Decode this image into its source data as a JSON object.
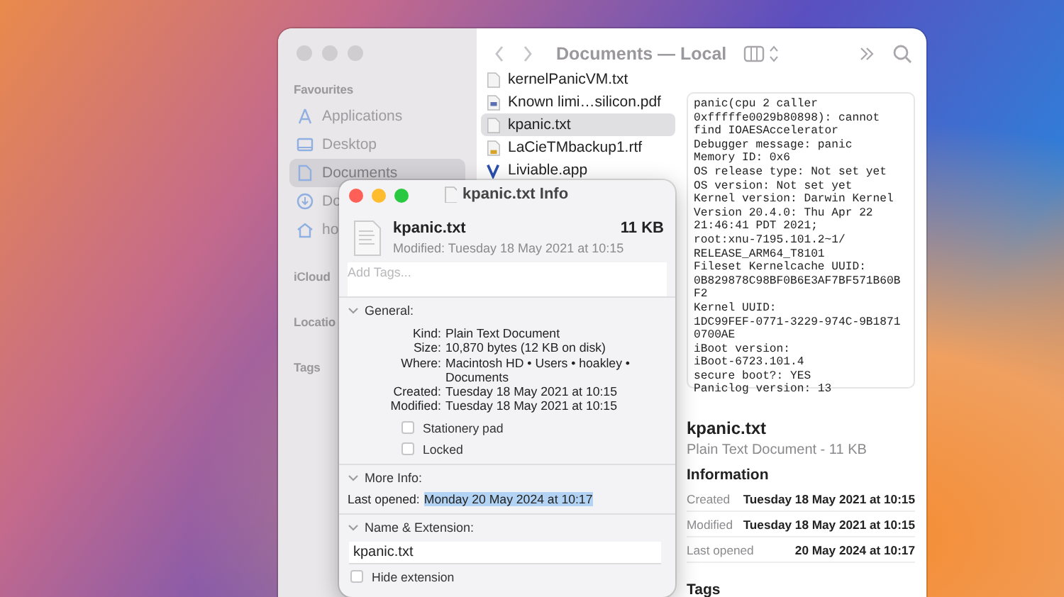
{
  "finder": {
    "title": "Documents — Local",
    "sidebar": {
      "sections": [
        {
          "label": "Favourites",
          "items": [
            {
              "label": "Applications",
              "selected": false
            },
            {
              "label": "Desktop",
              "selected": false
            },
            {
              "label": "Documents",
              "selected": true
            },
            {
              "label": "Do",
              "selected": false
            },
            {
              "label": "ho",
              "selected": false
            }
          ]
        },
        {
          "label": "iCloud"
        },
        {
          "label": "Locatio"
        },
        {
          "label": "Tags"
        }
      ]
    },
    "files": [
      {
        "name": "kernelPanicVM.txt",
        "kind": "text",
        "selected": false
      },
      {
        "name": "Known limi…silicon.pdf",
        "kind": "pdf",
        "selected": false
      },
      {
        "name": "kpanic.txt",
        "kind": "text",
        "selected": true
      },
      {
        "name": "LaCieTMbackup1.rtf",
        "kind": "rtf",
        "selected": false
      },
      {
        "name": "Liviable.app",
        "kind": "app",
        "selected": false
      }
    ],
    "preview": {
      "lines": [
        "panic(cpu 2 caller",
        "0xfffffe0029b80898): cannot",
        "find IOAESAccelerator",
        "Debugger message: panic",
        "Memory ID: 0x6",
        "OS release type: Not set yet",
        "OS version: Not set yet",
        "Kernel version: Darwin Kernel",
        "Version 20.4.0: Thu Apr 22",
        "21:46:41 PDT 2021;",
        "root:xnu-7195.101.2~1/",
        "RELEASE_ARM64_T8101",
        "Fileset Kernelcache UUID:",
        "0B829878C98BF0B6E3AF7BF571B60B",
        "F2",
        "Kernel UUID:",
        "1DC99FEF-0771-3229-974C-9B1871",
        "0700AE",
        "iBoot version:",
        "iBoot-6723.101.4",
        "secure boot?: YES",
        "Paniclog version: 13"
      ],
      "name": "kpanic.txt",
      "subtitle": "Plain Text Document - 11 KB",
      "info_heading": "Information",
      "rows": [
        {
          "label": "Created",
          "value": "Tuesday 18 May 2021 at 10:15"
        },
        {
          "label": "Modified",
          "value": "Tuesday 18 May 2021 at 10:15"
        },
        {
          "label": "Last opened",
          "value": "20 May 2024 at 10:17"
        }
      ],
      "tags_heading": "Tags"
    }
  },
  "info": {
    "title": "kpanic.txt Info",
    "name": "kpanic.txt",
    "size": "11 KB",
    "modified": "Modified: Tuesday 18 May 2021 at 10:15",
    "tags": {
      "placeholder": "Add Tags..."
    },
    "general": {
      "label": "General:",
      "expanded": true,
      "rows": [
        {
          "label": "Kind:",
          "value": "Plain Text Document"
        },
        {
          "label": "Size:",
          "value": "10,870 bytes (12 KB on disk)"
        },
        {
          "label": "Where:",
          "value": "Macintosh HD • Users • hoakley • Documents"
        },
        {
          "label": "Created:",
          "value": "Tuesday 18 May 2021 at 10:15"
        },
        {
          "label": "Modified:",
          "value": "Tuesday 18 May 2021 at 10:15"
        }
      ],
      "checkboxes": [
        {
          "label": "Stationery pad",
          "checked": false
        },
        {
          "label": "Locked",
          "checked": false
        }
      ]
    },
    "more_info": {
      "label": "More Info:",
      "expanded": true,
      "last_opened_label": "Last opened:",
      "last_opened": "Monday 20 May 2024 at 10:17",
      "selected": true
    },
    "name_extension": {
      "label": "Name & Extension:",
      "expanded": true,
      "value": "kpanic.txt",
      "hide_extension": {
        "label": "Hide extension",
        "checked": false
      }
    }
  }
}
